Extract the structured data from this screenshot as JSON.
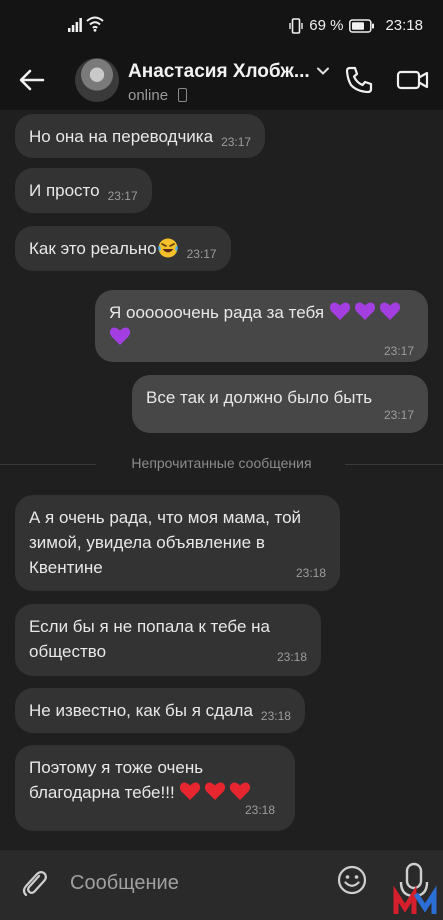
{
  "status_bar": {
    "battery": "69 %",
    "time": "23:18",
    "icons": [
      "signal-icon",
      "wifi-icon",
      "vibrate-icon",
      "battery-icon"
    ]
  },
  "header": {
    "contact_name": "Анастасия Хлобж...",
    "status": "online",
    "icons": [
      "back-arrow-icon",
      "chevron-down-icon",
      "phone-icon",
      "video-camera-icon",
      "mobile-device-icon"
    ]
  },
  "messages": [
    {
      "direction": "in",
      "text": "Но она на переводчика",
      "time": "23:17"
    },
    {
      "direction": "in",
      "text": "И просто",
      "time": "23:17"
    },
    {
      "direction": "in",
      "text": "Как это реально",
      "emoji": "laughing-tears-emoji",
      "time": "23:17"
    },
    {
      "direction": "out",
      "text": "Я оооооочень рада за тебя",
      "emoji": "purple-heart-emoji x4",
      "time": "23:17"
    },
    {
      "direction": "out",
      "text": "Все так и должно было быть",
      "time": "23:17"
    },
    {
      "direction": "in",
      "text": "А я очень рада, что моя мама, той зимой, увидела объявление в Квентине",
      "time": "23:18"
    },
    {
      "direction": "in",
      "text": "Если бы я не попала к тебе на общество",
      "time": "23:18"
    },
    {
      "direction": "in",
      "text": "Не известно, как бы я сдала",
      "time": "23:18"
    },
    {
      "direction": "in",
      "text": "Поэтому я тоже очень благодарна тебе!!!",
      "emoji": "red-heart-emoji x3",
      "time": "23:18"
    }
  ],
  "divider": {
    "label": "Непрочитанные сообщения"
  },
  "composer": {
    "placeholder": "Сообщение",
    "icons": [
      "paperclip-icon",
      "smiley-icon",
      "microphone-icon"
    ]
  },
  "colors": {
    "background": "#1f1f1f",
    "bar": "#141414",
    "incoming_bubble": "#333333",
    "outgoing_bubble": "#474747",
    "purple_heart": "#a33ee0",
    "red_heart": "#e8262f"
  }
}
